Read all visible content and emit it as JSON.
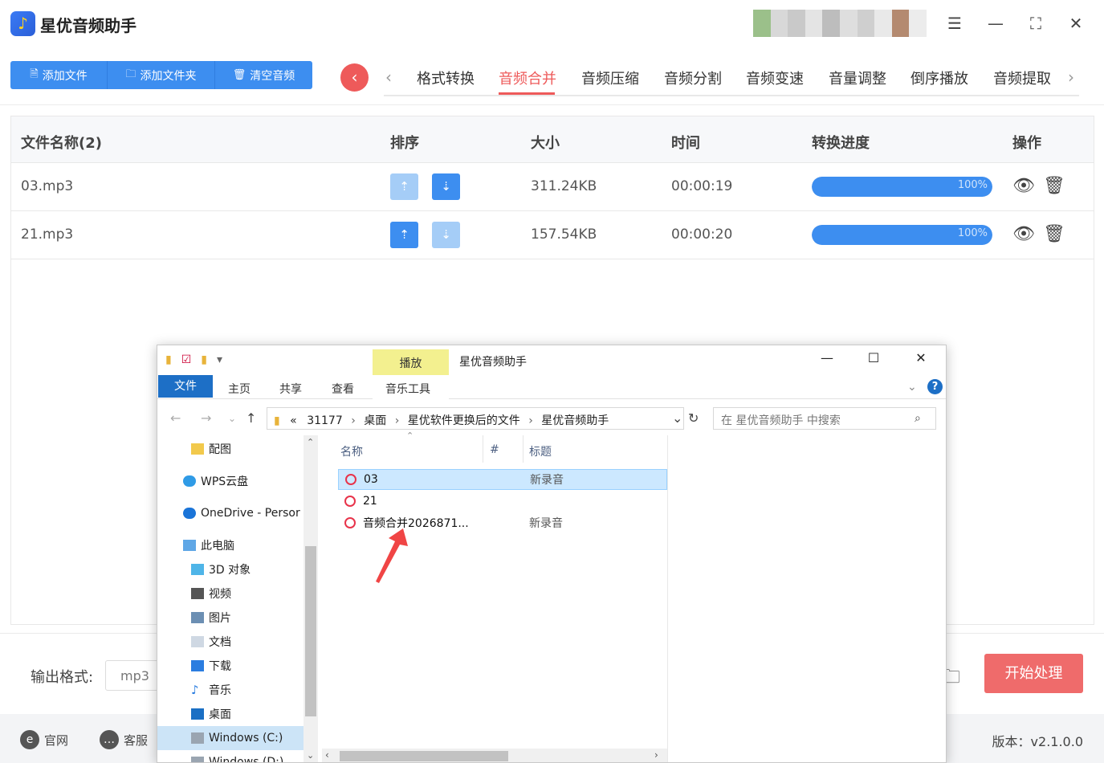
{
  "app": {
    "title": "星优音频助手",
    "icon": "music-note-icon"
  },
  "toolbar": {
    "add_file": "添加文件",
    "add_folder": "添加文件夹",
    "clear_audio": "清空音频"
  },
  "tabs": [
    "格式转换",
    "音频合并",
    "音频压缩",
    "音频分割",
    "音频变速",
    "音量调整",
    "倒序播放",
    "音频提取"
  ],
  "active_tab": "音频合并",
  "table": {
    "headers": [
      "文件名称(2)",
      "排序",
      "大小",
      "时间",
      "转换进度",
      "操作"
    ],
    "rows": [
      {
        "name": "03.mp3",
        "size": "311.24KB",
        "time": "00:00:19",
        "progress_label": "100%",
        "progress": 100
      },
      {
        "name": "21.mp3",
        "size": "157.54KB",
        "time": "00:00:20",
        "progress_label": "100%",
        "progress": 100
      }
    ]
  },
  "bottom": {
    "output_format_label": "输出格式:",
    "output_format_value": "mp3",
    "start_button": "开始处理"
  },
  "footer": {
    "website": "官网",
    "support": "客服",
    "version": "版本：v2.1.0.0"
  },
  "explorer": {
    "title": "星优音频助手",
    "context_tab": "播放",
    "ribbon_tabs": [
      "文件",
      "主页",
      "共享",
      "查看",
      "音乐工具"
    ],
    "address": {
      "prefix": "«",
      "parts": [
        "31177",
        "桌面",
        "星优软件更换后的文件",
        "星优音频助手"
      ]
    },
    "search_placeholder": "在 星优音频助手 中搜索",
    "sidebar": [
      {
        "label": "配图",
        "icon": "folder-icon"
      },
      {
        "label": "WPS云盘",
        "icon": "cloud-icon"
      },
      {
        "label": "OneDrive - Persor",
        "icon": "onedrive-icon"
      },
      {
        "label": "此电脑",
        "icon": "computer-icon"
      },
      {
        "label": "3D 对象",
        "icon": "cube-icon"
      },
      {
        "label": "视频",
        "icon": "video-icon"
      },
      {
        "label": "图片",
        "icon": "picture-icon"
      },
      {
        "label": "文档",
        "icon": "document-icon"
      },
      {
        "label": "下载",
        "icon": "download-icon"
      },
      {
        "label": "音乐",
        "icon": "music-icon"
      },
      {
        "label": "桌面",
        "icon": "desktop-icon"
      },
      {
        "label": "Windows (C:)",
        "icon": "drive-icon"
      },
      {
        "label": "Windows (D:)",
        "icon": "drive-icon"
      }
    ],
    "columns": [
      "名称",
      "#",
      "标题"
    ],
    "files": [
      {
        "name": "03",
        "title": "新录音"
      },
      {
        "name": "21",
        "title": ""
      },
      {
        "name": "音频合并2026871...",
        "title": "新录音"
      }
    ]
  },
  "colors": {
    "accent_blue": "#3d8ef0",
    "accent_red": "#ee5a5a",
    "start_button": "#ef6b6b"
  }
}
